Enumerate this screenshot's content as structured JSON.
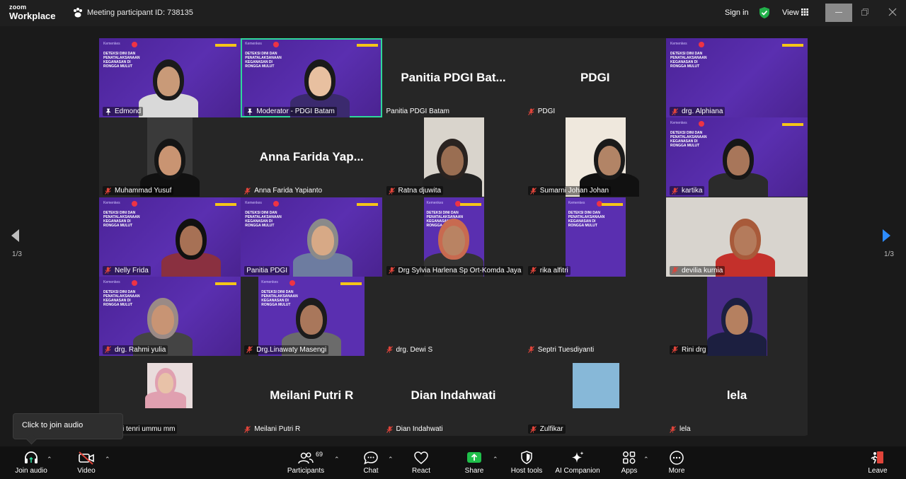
{
  "titlebar": {
    "logo_top": "zoom",
    "logo_bottom": "Workplace",
    "meeting_id": "Meeting participant ID: 738135",
    "sign_in": "Sign in",
    "view": "View"
  },
  "banner": {
    "top": "Kemenkes",
    "title": "DETEKSI DINI DAN PENATALAKSANAAN KEGANASAN DI RONGGA MULUT"
  },
  "tiles": [
    {
      "name": "Edmond",
      "big": "",
      "icon": "pin",
      "style": "purple"
    },
    {
      "name": "Moderator - PDGI Batam",
      "big": "",
      "icon": "pin",
      "style": "purple"
    },
    {
      "name": "Panitia PDGI Batam",
      "big": "Panitia PDGI Bat...",
      "icon": "none",
      "style": "dark"
    },
    {
      "name": "PDGI",
      "big": "PDGI",
      "icon": "mic-off",
      "style": "dark"
    },
    {
      "name": "drg. Alphiana",
      "big": "",
      "icon": "mic-off",
      "style": "purple"
    },
    {
      "name": "Muhammad Yusuf",
      "big": "",
      "icon": "mic-off",
      "style": "dark"
    },
    {
      "name": "Anna Farida Yapianto",
      "big": "Anna Farida Yap...",
      "icon": "mic-off",
      "style": "dark"
    },
    {
      "name": "Ratna djuwita",
      "big": "",
      "icon": "mic-off",
      "style": "dark"
    },
    {
      "name": "Sumarni Johan Johan",
      "big": "",
      "icon": "mic-off",
      "style": "dark"
    },
    {
      "name": "kartika",
      "big": "",
      "icon": "mic-off",
      "style": "purple"
    },
    {
      "name": "Nelly Frida",
      "big": "",
      "icon": "mic-off",
      "style": "purple"
    },
    {
      "name": "Panitia PDGI",
      "big": "",
      "icon": "none",
      "style": "purple"
    },
    {
      "name": "Drg Sylvia Harlena Sp Ort-Komda Jaya",
      "big": "",
      "icon": "mic-off",
      "style": "dark"
    },
    {
      "name": "rika alfitri",
      "big": "",
      "icon": "mic-off",
      "style": "dark"
    },
    {
      "name": "devilia kurnia",
      "big": "",
      "icon": "mic-off",
      "style": "dark"
    },
    {
      "name": "drg. Rahmi yulia",
      "big": "",
      "icon": "mic-off",
      "style": "purple"
    },
    {
      "name": "Drg.Linawaty Masengi",
      "big": "",
      "icon": "mic-off",
      "style": "dark"
    },
    {
      "name": "drg. Dewi S",
      "big": "",
      "icon": "mic-off",
      "style": "dark"
    },
    {
      "name": "Septri Tuesdiyanti",
      "big": "",
      "icon": "mic-off",
      "style": "dark"
    },
    {
      "name": "Rini drg",
      "big": "",
      "icon": "mic-off",
      "style": "dark"
    },
    {
      "name": "g andi tenri ummu mm",
      "big": "",
      "icon": "none",
      "style": "dark"
    },
    {
      "name": "Meilani Putri R",
      "big": "Meilani Putri R",
      "icon": "mic-off",
      "style": "dark"
    },
    {
      "name": "Dian Indahwati",
      "big": "Dian Indahwati",
      "icon": "mic-off",
      "style": "dark"
    },
    {
      "name": "Zulfikar",
      "big": "",
      "icon": "mic-off",
      "style": "dark"
    },
    {
      "name": "lela",
      "big": "lela",
      "icon": "mic-off",
      "style": "dark"
    }
  ],
  "nav": {
    "left_page": "1/3",
    "right_page": "1/3"
  },
  "tooltip": "Click to join audio",
  "toolbar": {
    "join_audio": "Join audio",
    "video": "Video",
    "participants": "Participants",
    "participants_count": "69",
    "chat": "Chat",
    "react": "React",
    "share": "Share",
    "host_tools": "Host tools",
    "ai_companion": "AI Companion",
    "apps": "Apps",
    "more": "More",
    "leave": "Leave"
  },
  "colors": {
    "accent_green": "#2fd89b",
    "share_green": "#1fbf4a",
    "tile_purple": "#5a2fb0",
    "mic_red": "#e0443a",
    "nav_blue": "#2d8cff"
  }
}
